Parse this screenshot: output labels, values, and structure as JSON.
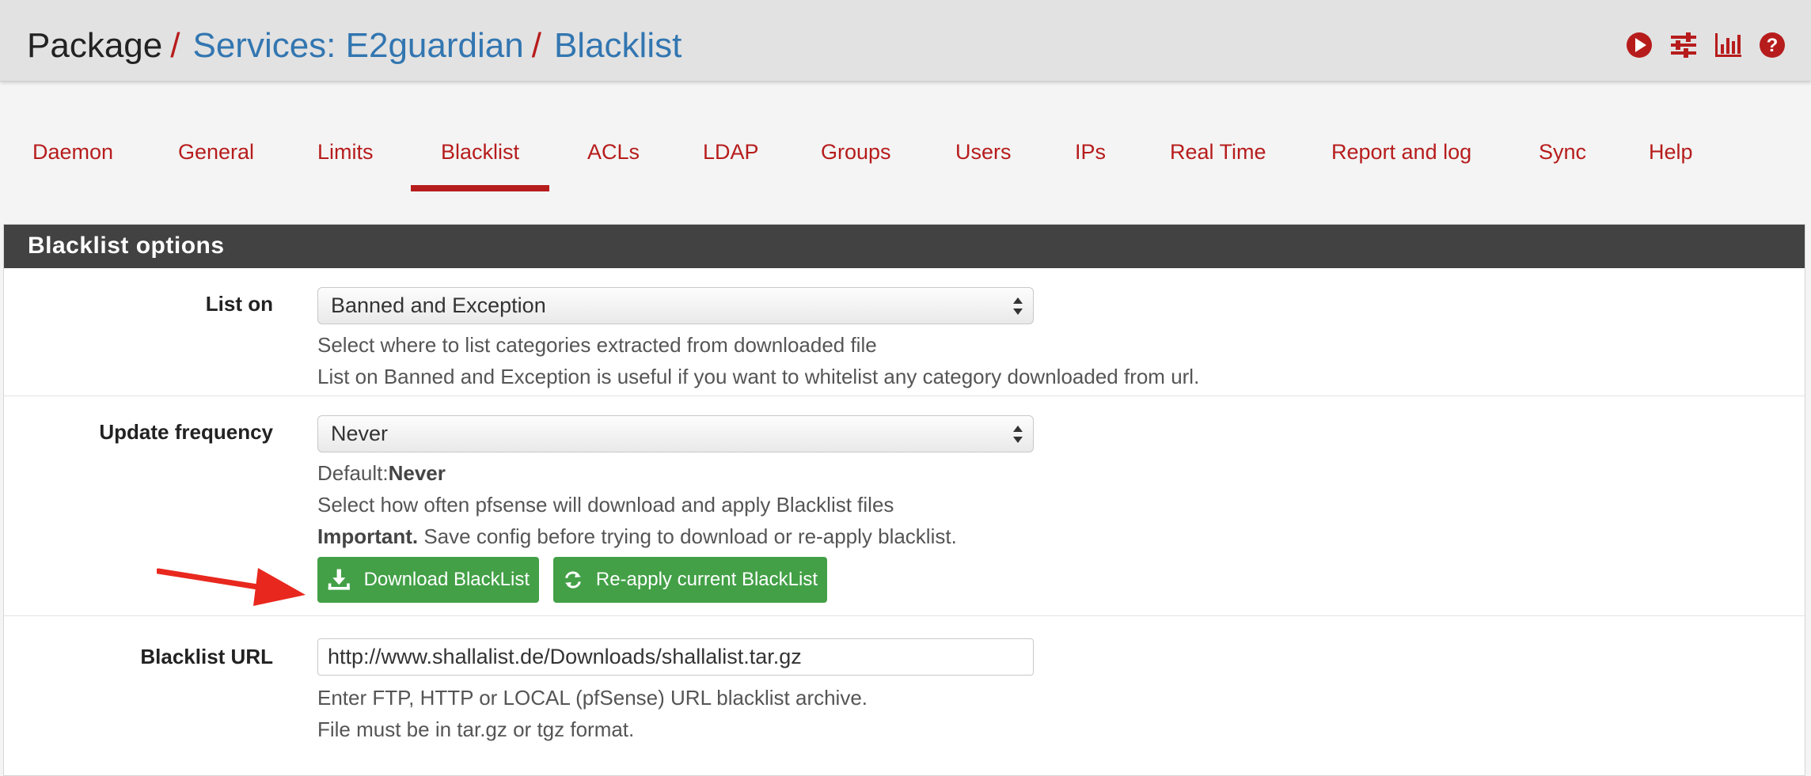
{
  "breadcrumb": {
    "root": "Package",
    "sep": "/",
    "service": "Services: E2guardian",
    "page": "Blacklist"
  },
  "header_icons": [
    "play-circle-icon",
    "sliders-icon",
    "bar-chart-icon",
    "help-circle-icon"
  ],
  "colors": {
    "accent": "#b71c1c",
    "link": "#3276b1",
    "success": "#43a047",
    "panel_head": "#424242"
  },
  "tabs": [
    {
      "label": "Daemon",
      "active": false
    },
    {
      "label": "General",
      "active": false
    },
    {
      "label": "Limits",
      "active": false
    },
    {
      "label": "Blacklist",
      "active": true
    },
    {
      "label": "ACLs",
      "active": false
    },
    {
      "label": "LDAP",
      "active": false
    },
    {
      "label": "Groups",
      "active": false
    },
    {
      "label": "Users",
      "active": false
    },
    {
      "label": "IPs",
      "active": false
    },
    {
      "label": "Real Time",
      "active": false
    },
    {
      "label": "Report and log",
      "active": false
    },
    {
      "label": "Sync",
      "active": false
    },
    {
      "label": "Help",
      "active": false
    }
  ],
  "panel": {
    "title": "Blacklist options",
    "list_on": {
      "label": "List on",
      "value": "Banned and Exception",
      "help1": "Select where to list categories extracted from downloaded file",
      "help2": "List on Banned and Exception is useful if you want to whitelist any category downloaded from url."
    },
    "update_frequency": {
      "label": "Update frequency",
      "value": "Never",
      "default_prefix": "Default:",
      "default_value": "Never",
      "help1": "Select how often pfsense will download and apply Blacklist files",
      "important_label": "Important.",
      "important_text": " Save config before trying to download or re-apply blacklist.",
      "download_button": "Download BlackList",
      "reapply_button": "Re-apply current BlackList"
    },
    "blacklist_url": {
      "label": "Blacklist URL",
      "value": "http://www.shallalist.de/Downloads/shallalist.tar.gz",
      "help1": "Enter FTP, HTTP or LOCAL (pfSense) URL blacklist archive.",
      "help2": "File must be in tar.gz or tgz format."
    }
  }
}
